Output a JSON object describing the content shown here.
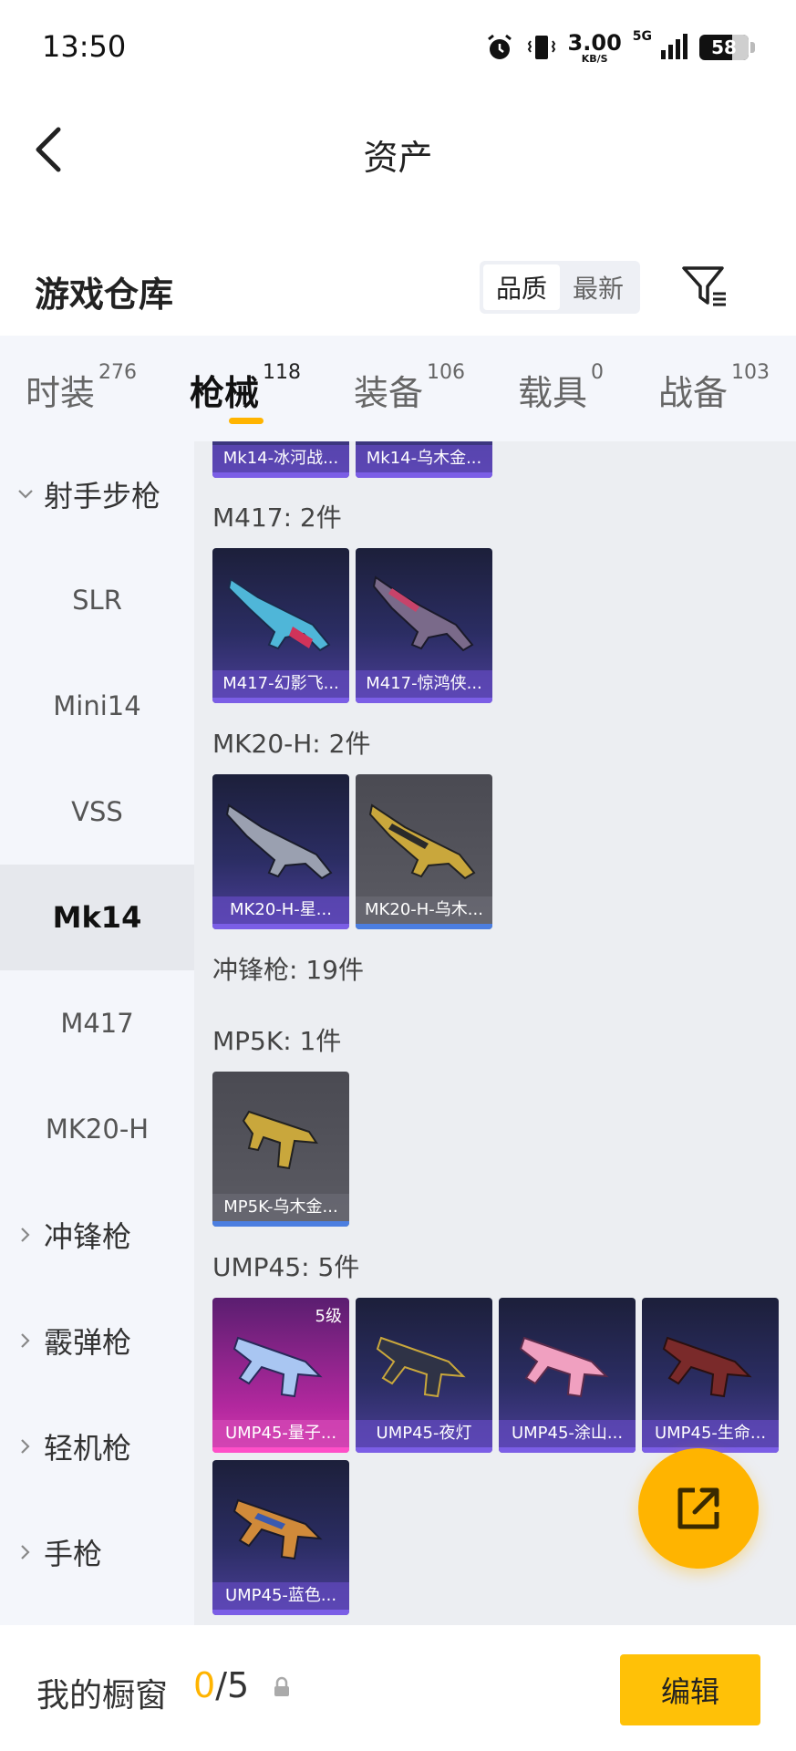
{
  "status_bar": {
    "time": "13:50",
    "net_speed": "3.00",
    "net_unit": "KB/S",
    "network": "5G",
    "battery": "58"
  },
  "header": {
    "title": "资产"
  },
  "warehouse": {
    "title": "游戏仓库",
    "sort_options": [
      "品质",
      "最新"
    ],
    "active_sort": "品质"
  },
  "tabs": [
    {
      "label": "时装",
      "count": "276"
    },
    {
      "label": "枪械",
      "count": "118"
    },
    {
      "label": "装备",
      "count": "106"
    },
    {
      "label": "载具",
      "count": "0"
    },
    {
      "label": "战备",
      "count": "103"
    }
  ],
  "active_tab": "枪械",
  "sidebar": {
    "items": [
      "射手步枪",
      "SLR",
      "Mini14",
      "VSS",
      "Mk14",
      "M417",
      "MK20-H",
      "冲锋枪",
      "霰弹枪",
      "轻机枪",
      "手枪"
    ],
    "active": "Mk14"
  },
  "content": {
    "top_partial_cards": [
      "Mk14-冰河战...",
      "Mk14-乌木金..."
    ],
    "sections": [
      {
        "title": "M417: 2件",
        "cards": [
          "M417-幻影飞...",
          "M417-惊鸿侠..."
        ]
      },
      {
        "title": "MK20-H: 2件",
        "cards": [
          "MK20-H-星...",
          "MK20-H-乌木..."
        ]
      },
      {
        "title": "冲锋枪: 19件"
      },
      {
        "title": "MP5K: 1件",
        "cards": [
          "MP5K-乌木金..."
        ]
      },
      {
        "title": "UMP45: 5件",
        "cards": [
          "UMP45-量子...",
          "UMP45-夜灯",
          "UMP45-涂山...",
          "UMP45-生命...",
          "UMP45-蓝色..."
        ],
        "first_card_level": "5级"
      }
    ]
  },
  "bottom_bar": {
    "title": "我的橱窗",
    "current": "0",
    "total": "/5",
    "edit_label": "编辑"
  },
  "colors": {
    "accent": "#ffb400",
    "edit_button": "#ffc107"
  }
}
